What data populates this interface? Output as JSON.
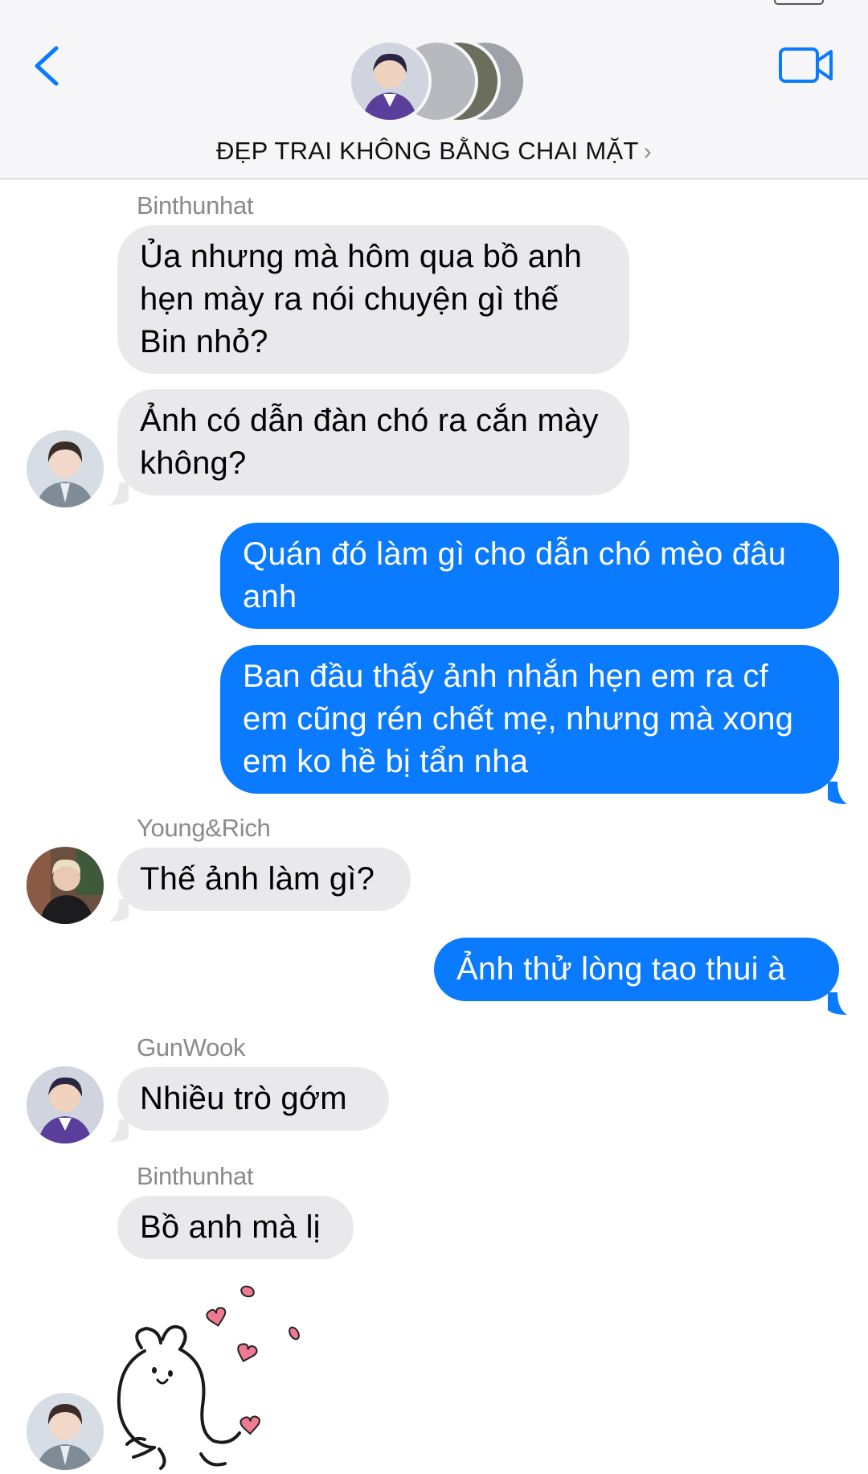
{
  "header": {
    "group_name": "ĐẸP TRAI KHÔNG BẰNG CHAI MẶT",
    "title_chevron": "›",
    "icons": {
      "back": "chevron-left-icon",
      "video": "video-camera-icon"
    }
  },
  "colors": {
    "accent": "#0a7aff",
    "incoming_bubble": "#e9e9eb",
    "header_bg": "#f6f6f8",
    "sticker_hearts": "#f07b90"
  },
  "messages": [
    {
      "sender": "Binthunhat",
      "direction": "incoming",
      "text": "Ủa nhưng mà hôm qua bồ anh hẹn mày ra nói chuyện gì thế Bin nhỏ?"
    },
    {
      "direction": "incoming",
      "text": "Ảnh có dẫn đàn chó ra cắn mày không?"
    },
    {
      "direction": "outgoing",
      "text": "Quán đó làm gì cho dẫn chó mèo đâu anh"
    },
    {
      "direction": "outgoing",
      "text": "Ban đầu thấy ảnh nhắn hẹn em ra cf em cũng rén chết mẹ, nhưng mà xong em ko hề bị tẩn nha"
    },
    {
      "sender": "Young&Rich",
      "direction": "incoming",
      "text": "Thế ảnh làm gì?"
    },
    {
      "direction": "outgoing",
      "text": "Ảnh thử lòng tao thui à"
    },
    {
      "sender": "GunWook",
      "direction": "incoming",
      "text": "Nhiều trò gớm"
    },
    {
      "sender": "Binthunhat",
      "direction": "incoming",
      "text": "Bồ anh mà lị"
    },
    {
      "direction": "incoming",
      "sticker": "rabbit-hearts-sticker"
    }
  ]
}
